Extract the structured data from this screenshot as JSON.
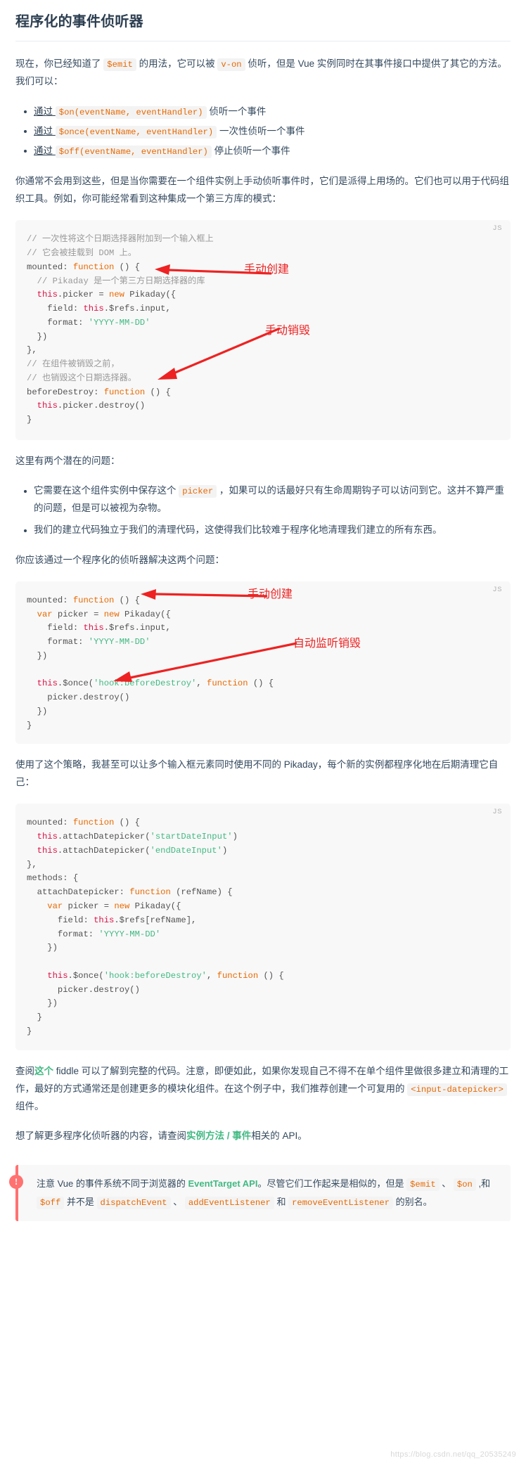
{
  "page": {
    "title": "程序化的事件侦听器",
    "watermark": "https://blog.csdn.net/qq_20535249"
  },
  "intro": {
    "part1": "现在，你已经知道了 ",
    "code1": "$emit",
    "part2": " 的用法，它可以被 ",
    "code2": "v-on",
    "part3": " 侦听，但是 Vue 实例同时在其事件接口中提供了其它的方法。我们可以："
  },
  "method_list": [
    {
      "prefix": "通过 ",
      "code": "$on(eventName, eventHandler)",
      "suffix": " 侦听一个事件"
    },
    {
      "prefix": "通过 ",
      "code": "$once(eventName, eventHandler)",
      "suffix": " 一次性侦听一个事件"
    },
    {
      "prefix": "通过 ",
      "code": "$off(eventName, eventHandler)",
      "suffix": " 停止侦听一个事件"
    }
  ],
  "para_usage": "你通常不会用到这些，但是当你需要在一个组件实例上手动侦听事件时，它们是派得上用场的。它们也可以用于代码组织工具。例如，你可能经常看到这种集成一个第三方库的模式：",
  "code_block_1": {
    "lang": "JS",
    "lines": [
      [
        {
          "t": "cm",
          "s": "// 一次性将这个日期选择器附加到一个输入框上"
        }
      ],
      [
        {
          "t": "cm",
          "s": "// 它会被挂载到 DOM 上。"
        }
      ],
      [
        {
          "t": "pl",
          "s": "mounted: "
        },
        {
          "t": "k",
          "s": "function"
        },
        {
          "t": "pl",
          "s": " () {"
        }
      ],
      [
        {
          "t": "cm",
          "s": "  // Pikaday 是一个第三方日期选择器的库"
        }
      ],
      [
        {
          "t": "this",
          "s": "  this"
        },
        {
          "t": "pl",
          "s": ".picker = "
        },
        {
          "t": "k",
          "s": "new"
        },
        {
          "t": "pl",
          "s": " Pikaday({"
        }
      ],
      [
        {
          "t": "pl",
          "s": "    field: "
        },
        {
          "t": "this",
          "s": "this"
        },
        {
          "t": "pl",
          "s": ".$refs.input,"
        }
      ],
      [
        {
          "t": "pl",
          "s": "    format: "
        },
        {
          "t": "st",
          "s": "'YYYY-MM-DD'"
        }
      ],
      [
        {
          "t": "pl",
          "s": "  })"
        }
      ],
      [
        {
          "t": "pl",
          "s": "},"
        }
      ],
      [
        {
          "t": "cm",
          "s": "// 在组件被销毁之前，"
        }
      ],
      [
        {
          "t": "cm",
          "s": "// 也销毁这个日期选择器。"
        }
      ],
      [
        {
          "t": "pl",
          "s": "beforeDestroy: "
        },
        {
          "t": "k",
          "s": "function"
        },
        {
          "t": "pl",
          "s": " () {"
        }
      ],
      [
        {
          "t": "this",
          "s": "  this"
        },
        {
          "t": "pl",
          "s": ".picker.destroy()"
        }
      ],
      [
        {
          "t": "pl",
          "s": "}"
        }
      ]
    ],
    "annotations": [
      {
        "label": "手动创建"
      },
      {
        "label": "手动销毁"
      }
    ]
  },
  "para_problems": "这里有两个潜在的问题：",
  "problem_list": [
    {
      "prefix": "它需要在这个组件实例中保存这个 ",
      "code": "picker",
      "suffix": " ，如果可以的话最好只有生命周期钩子可以访问到它。这并不算严重的问题，但是可以被视为杂物。"
    },
    {
      "prefix": "我们的建立代码独立于我们的清理代码，这使得我们比较难于程序化地清理我们建立的所有东西。",
      "code": "",
      "suffix": ""
    }
  ],
  "para_solution": "你应该通过一个程序化的侦听器解决这两个问题：",
  "code_block_2": {
    "lang": "JS",
    "lines": [
      [
        {
          "t": "pl",
          "s": "mounted: "
        },
        {
          "t": "k",
          "s": "function"
        },
        {
          "t": "pl",
          "s": " () {"
        }
      ],
      [
        {
          "t": "k",
          "s": "  var"
        },
        {
          "t": "pl",
          "s": " picker = "
        },
        {
          "t": "k",
          "s": "new"
        },
        {
          "t": "pl",
          "s": " Pikaday({"
        }
      ],
      [
        {
          "t": "pl",
          "s": "    field: "
        },
        {
          "t": "this",
          "s": "this"
        },
        {
          "t": "pl",
          "s": ".$refs.input,"
        }
      ],
      [
        {
          "t": "pl",
          "s": "    format: "
        },
        {
          "t": "st",
          "s": "'YYYY-MM-DD'"
        }
      ],
      [
        {
          "t": "pl",
          "s": "  })"
        }
      ],
      [
        {
          "t": "pl",
          "s": ""
        }
      ],
      [
        {
          "t": "this",
          "s": "  this"
        },
        {
          "t": "pl",
          "s": ".$once("
        },
        {
          "t": "st",
          "s": "'hook:beforeDestroy'"
        },
        {
          "t": "pl",
          "s": ", "
        },
        {
          "t": "k",
          "s": "function"
        },
        {
          "t": "pl",
          "s": " () {"
        }
      ],
      [
        {
          "t": "pl",
          "s": "    picker.destroy()"
        }
      ],
      [
        {
          "t": "pl",
          "s": "  })"
        }
      ],
      [
        {
          "t": "pl",
          "s": "}"
        }
      ]
    ],
    "annotations": [
      {
        "label": "手动创建"
      },
      {
        "label": "自动监听销毁"
      }
    ]
  },
  "para_strategy": "使用了这个策略，我甚至可以让多个输入框元素同时使用不同的 Pikaday，每个新的实例都程序化地在后期清理它自己：",
  "code_block_3": {
    "lang": "JS",
    "lines": [
      [
        {
          "t": "pl",
          "s": "mounted: "
        },
        {
          "t": "k",
          "s": "function"
        },
        {
          "t": "pl",
          "s": " () {"
        }
      ],
      [
        {
          "t": "this",
          "s": "  this"
        },
        {
          "t": "pl",
          "s": ".attachDatepicker("
        },
        {
          "t": "st",
          "s": "'startDateInput'"
        },
        {
          "t": "pl",
          "s": ")"
        }
      ],
      [
        {
          "t": "this",
          "s": "  this"
        },
        {
          "t": "pl",
          "s": ".attachDatepicker("
        },
        {
          "t": "st",
          "s": "'endDateInput'"
        },
        {
          "t": "pl",
          "s": ")"
        }
      ],
      [
        {
          "t": "pl",
          "s": "},"
        }
      ],
      [
        {
          "t": "pl",
          "s": "methods: {"
        }
      ],
      [
        {
          "t": "pl",
          "s": "  attachDatepicker: "
        },
        {
          "t": "k",
          "s": "function"
        },
        {
          "t": "pl",
          "s": " (refName) {"
        }
      ],
      [
        {
          "t": "k",
          "s": "    var"
        },
        {
          "t": "pl",
          "s": " picker = "
        },
        {
          "t": "k",
          "s": "new"
        },
        {
          "t": "pl",
          "s": " Pikaday({"
        }
      ],
      [
        {
          "t": "pl",
          "s": "      field: "
        },
        {
          "t": "this",
          "s": "this"
        },
        {
          "t": "pl",
          "s": ".$refs[refName],"
        }
      ],
      [
        {
          "t": "pl",
          "s": "      format: "
        },
        {
          "t": "st",
          "s": "'YYYY-MM-DD'"
        }
      ],
      [
        {
          "t": "pl",
          "s": "    })"
        }
      ],
      [
        {
          "t": "pl",
          "s": ""
        }
      ],
      [
        {
          "t": "this",
          "s": "    this"
        },
        {
          "t": "pl",
          "s": ".$once("
        },
        {
          "t": "st",
          "s": "'hook:beforeDestroy'"
        },
        {
          "t": "pl",
          "s": ", "
        },
        {
          "t": "k",
          "s": "function"
        },
        {
          "t": "pl",
          "s": " () {"
        }
      ],
      [
        {
          "t": "pl",
          "s": "      picker.destroy()"
        }
      ],
      [
        {
          "t": "pl",
          "s": "    })"
        }
      ],
      [
        {
          "t": "pl",
          "s": "  }"
        }
      ],
      [
        {
          "t": "pl",
          "s": "}"
        }
      ]
    ],
    "annotations": []
  },
  "para_fiddle": {
    "p1": "查阅",
    "link1": "这个",
    "p2": " fiddle 可以了解到完整的代码。注意，即便如此，如果你发现自己不得不在单个组件里做很多建立和清理的工作，最好的方式通常还是创建更多的模块化组件。在这个例子中，我们推荐创建一个可复用的 ",
    "code1": "<input-datepicker>",
    "p3": " 组件。"
  },
  "para_more": {
    "p1": "想了解更多程序化侦听器的内容，请查阅",
    "link1": "实例方法 / 事件",
    "p2": "相关的 API。"
  },
  "tip": {
    "badge": "!",
    "p1": "注意 Vue 的事件系统不同于浏览器的 ",
    "link1": "EventTarget API",
    "p2": "。尽管它们工作起来是相似的，但是 ",
    "code1": "$emit",
    "p3": " 、 ",
    "code2": "$on",
    "p4": " ,和 ",
    "code3": "$off",
    "p5": " 并不是 ",
    "code4": "dispatchEvent",
    "p6": " 、 ",
    "code5": "addEventListener",
    "p7": " 和 ",
    "code6": "removeEventListener",
    "p8": " 的别名。"
  },
  "colors": {
    "accent_green": "#42b983",
    "code_orange": "#e96900",
    "annotation_red": "#ee2222",
    "tip_red": "#ff7271",
    "heading": "#2c3e50"
  }
}
